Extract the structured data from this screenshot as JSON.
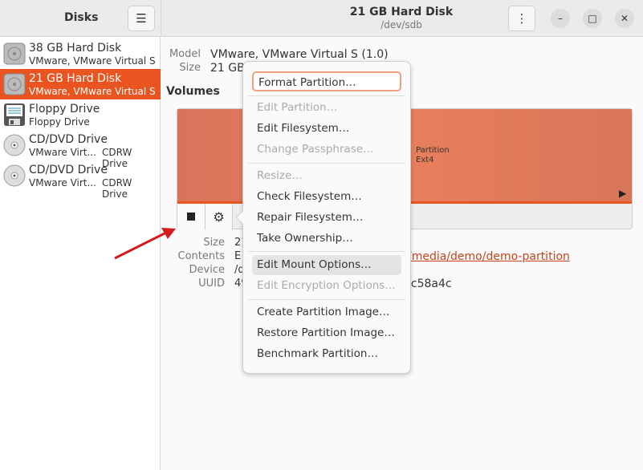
{
  "sidebar": {
    "title": "Disks",
    "menu_icon": "hamburger-icon",
    "drives": [
      {
        "name": "38 GB Hard Disk",
        "sub": "VMware, VMware Virtual S",
        "icon": "hard-disk-icon"
      },
      {
        "name": "21 GB Hard Disk",
        "sub": "VMware, VMware Virtual S",
        "icon": "hard-disk-icon",
        "selected": true
      },
      {
        "name": "Floppy Drive",
        "sub": "Floppy Drive",
        "icon": "floppy-icon"
      },
      {
        "name": "CD/DVD Drive",
        "sub": "VMware Virt...",
        "sub2": "CDRW Drive",
        "icon": "optical-disc-icon"
      },
      {
        "name": "CD/DVD Drive",
        "sub": "VMware Virt...",
        "sub2": "CDRW Drive",
        "icon": "optical-disc-icon"
      }
    ]
  },
  "header": {
    "title": "21 GB Hard Disk",
    "subtitle": "/dev/sdb"
  },
  "disk": {
    "model_label": "Model",
    "model": "VMware, VMware Virtual S (1.0)",
    "size_label": "Size",
    "size": "21 GB"
  },
  "volumes": {
    "heading": "Volumes",
    "partition_line1": "Partition",
    "partition_line2": "Ext4",
    "accent": "#e95420"
  },
  "details": {
    "size_label": "Size",
    "size": "21",
    "contents_label": "Contents",
    "contents": "E",
    "device_label": "Device",
    "device": "/d",
    "uuid_label": "UUID",
    "uuid": "49",
    "mount_link": "/media/demo/demo-partition",
    "uuid_tail": "lc58a4c"
  },
  "menu": {
    "items": [
      {
        "label": "Format Partition…",
        "enabled": true,
        "focused": true
      },
      {
        "label": "Edit Partition…",
        "enabled": false
      },
      {
        "label": "Edit Filesystem…",
        "enabled": true
      },
      {
        "label": "Change Passphrase…",
        "enabled": false
      },
      {
        "label": "Resize…",
        "enabled": false
      },
      {
        "label": "Check Filesystem…",
        "enabled": true
      },
      {
        "label": "Repair Filesystem…",
        "enabled": true
      },
      {
        "label": "Take Ownership…",
        "enabled": true
      },
      {
        "label": "Edit Mount Options…",
        "enabled": true,
        "hovered": true
      },
      {
        "label": "Edit Encryption Options…",
        "enabled": false
      },
      {
        "label": "Create Partition Image…",
        "enabled": true
      },
      {
        "label": "Restore Partition Image…",
        "enabled": true
      },
      {
        "label": "Benchmark Partition…",
        "enabled": true
      }
    ]
  }
}
